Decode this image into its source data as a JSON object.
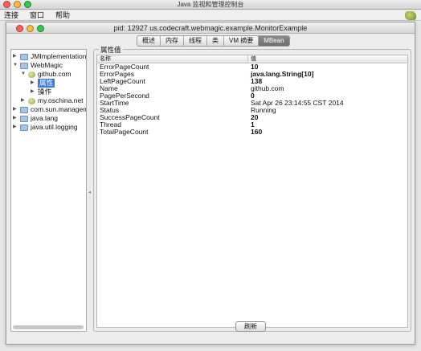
{
  "window": {
    "title": "Java 监视和管理控制台"
  },
  "menu": [
    "连接",
    "窗口",
    "帮助"
  ],
  "inner": {
    "title": "pid: 12927 us.codecraft.webmagic.example.MonitorExample"
  },
  "tabs": [
    {
      "label": "概述"
    },
    {
      "label": "内存"
    },
    {
      "label": "线程"
    },
    {
      "label": "类"
    },
    {
      "label": "VM 摘要"
    },
    {
      "label": "MBean",
      "active": true
    }
  ],
  "tree": {
    "jmimpl": "JMImplementation",
    "webmagic": "WebMagic",
    "github": "github.com",
    "attributes": "属性",
    "operations": "操作",
    "oschina": "my.oschina.net",
    "comsun": "com.sun.management",
    "javalang": "java.lang",
    "javalogging": "java.util.logging"
  },
  "attributes": {
    "group_title": "属性值",
    "col_name": "名称",
    "col_value": "值",
    "rows": [
      {
        "name": "ErrorPageCount",
        "value": "10",
        "bold": true
      },
      {
        "name": "ErrorPages",
        "value": "java.lang.String[10]",
        "bold": true
      },
      {
        "name": "LeftPageCount",
        "value": "138",
        "bold": true
      },
      {
        "name": "Name",
        "value": "github.com",
        "bold": false
      },
      {
        "name": "PagePerSecond",
        "value": "0",
        "bold": true
      },
      {
        "name": "StartTime",
        "value": "Sat Apr 26 23:14:55 CST 2014",
        "bold": false
      },
      {
        "name": "Status",
        "value": "Running",
        "bold": false
      },
      {
        "name": "SuccessPageCount",
        "value": "20",
        "bold": true
      },
      {
        "name": "Thread",
        "value": "1",
        "bold": true
      },
      {
        "name": "TotalPageCount",
        "value": "160",
        "bold": true
      }
    ]
  },
  "buttons": {
    "refresh": "刷新"
  }
}
